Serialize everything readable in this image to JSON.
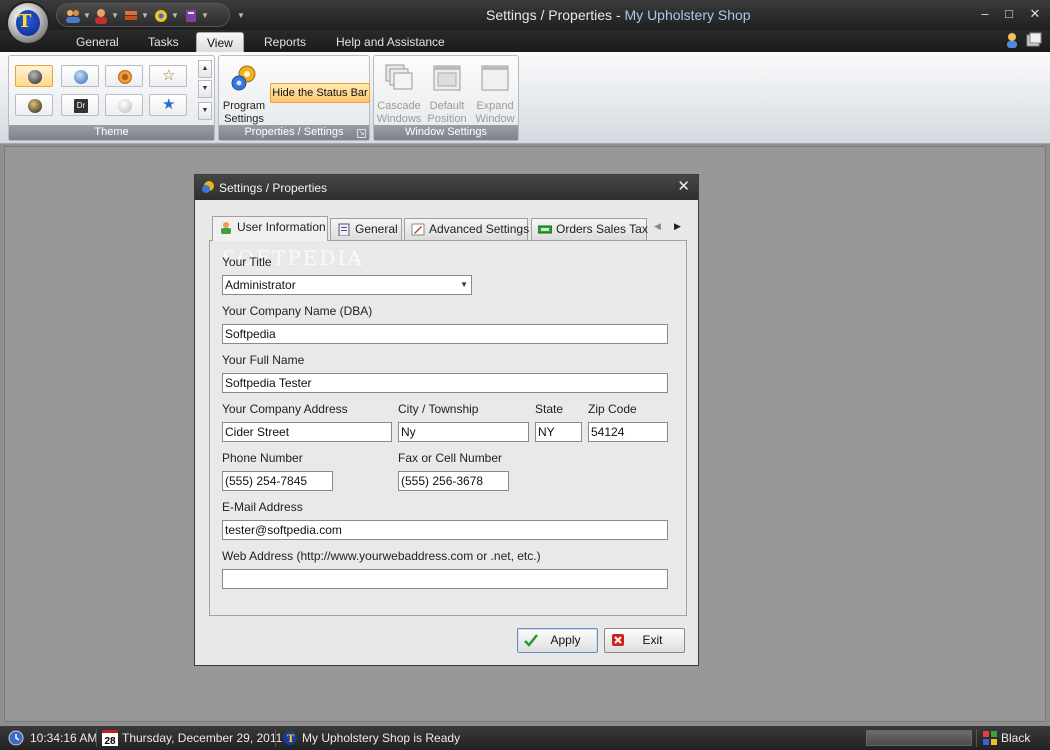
{
  "window": {
    "title_prefix": "Settings / Properties - ",
    "app_name": "My Upholstery Shop",
    "minimize": "–",
    "maximize": "□",
    "close": "✕"
  },
  "ribbon_tabs": [
    {
      "label": "General"
    },
    {
      "label": "Tasks"
    },
    {
      "label": "View",
      "active": true
    },
    {
      "label": "Reports"
    },
    {
      "label": "Help and Assistance"
    }
  ],
  "ribbon": {
    "theme_group_label": "Theme",
    "props_group_label": "Properties / Settings",
    "program_settings_label_1": "Program",
    "program_settings_label_2": "Settings",
    "hide_status_bar": "Hide the Status Bar",
    "window_group_label": "Window Settings",
    "cascade_1": "Cascade",
    "cascade_2": "Windows",
    "default_1": "Default",
    "default_2": "Position",
    "expand_1": "Expand",
    "expand_2": "Window",
    "theme_tile_dr": "Dr"
  },
  "dialog": {
    "title": "Settings / Properties",
    "close": "✕",
    "tabs": [
      {
        "label": "User Information",
        "icon": "user-icon",
        "active": true
      },
      {
        "label": "General",
        "icon": "document-icon"
      },
      {
        "label": "Advanced Settings",
        "icon": "pencil-icon"
      },
      {
        "label": "Orders Sales Tax",
        "icon": "tax-icon"
      }
    ],
    "watermark": "SOFTPEDIA",
    "fields": {
      "title_label": "Your Title",
      "title_value": "Administrator",
      "company_label": "Your Company Name (DBA)",
      "company_value": "Softpedia",
      "fullname_label": "Your Full Name",
      "fullname_value": "Softpedia Tester",
      "address_label": "Your Company Address",
      "address_value": "Cider Street",
      "city_label": "City / Township",
      "city_value": "Ny",
      "state_label": "State",
      "state_value": "NY",
      "zip_label": "Zip Code",
      "zip_value": "54124",
      "phone_label": "Phone Number",
      "phone_value": "(555) 254-7845",
      "fax_label": "Fax or Cell Number",
      "fax_value": "(555) 256-3678",
      "email_label": "E-Mail Address",
      "email_value": "tester@softpedia.com",
      "web_label": "Web Address (http://www.yourwebaddress.com or .net, etc.)",
      "web_value": ""
    },
    "apply_label": "Apply",
    "exit_label": "Exit"
  },
  "statusbar": {
    "time": "10:34:16 AM",
    "date_day": "28",
    "date": "Thursday, December 29, 2011",
    "status": "My Upholstery Shop is Ready",
    "theme_name": "Black"
  },
  "colors": {
    "accent": "#ffc86a",
    "titlebar": "#2e2e2e",
    "workspace": "#979797"
  }
}
